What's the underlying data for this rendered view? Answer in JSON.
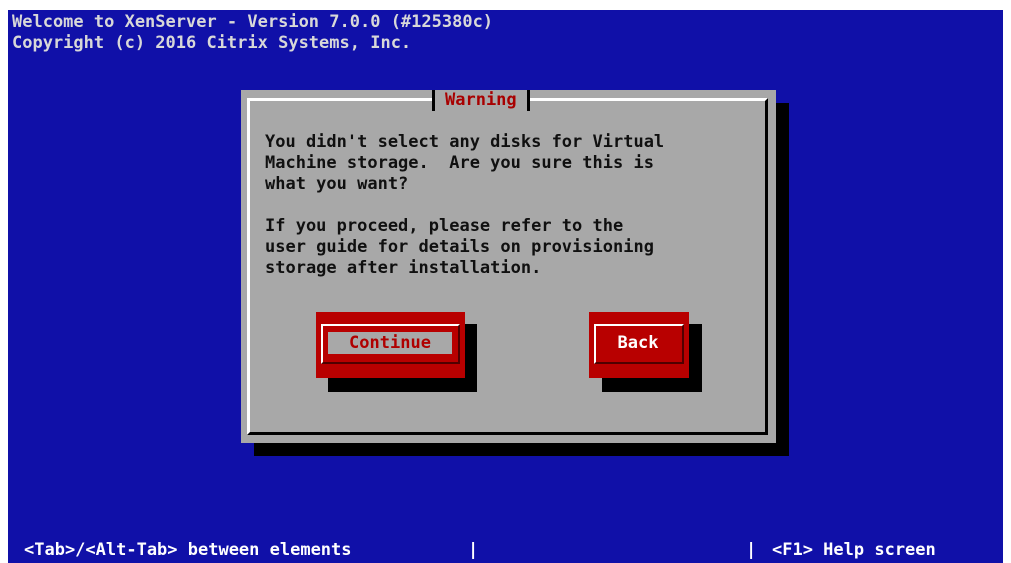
{
  "header": {
    "line1": "Welcome to XenServer - Version 7.0.0 (#125380c)",
    "line2": "Copyright (c) 2016 Citrix Systems, Inc."
  },
  "dialog": {
    "title": "Warning",
    "message_lines": [
      "You didn't select any disks for Virtual",
      "Machine storage.  Are you sure this is",
      "what you want?",
      "",
      "If you proceed, please refer to the",
      "user guide for details on provisioning",
      "storage after installation."
    ],
    "buttons": {
      "continue_label": "Continue",
      "back_label": "Back"
    },
    "focused_button": "Continue"
  },
  "status_bar": {
    "left_hint": "<Tab>/<Alt-Tab> between elements",
    "separator": "|",
    "right_hint": "<F1> Help screen"
  },
  "colors": {
    "background": "#1010a8",
    "dialog": "#a8a8a8",
    "title_text": "#a80000",
    "button": "#b80000"
  }
}
